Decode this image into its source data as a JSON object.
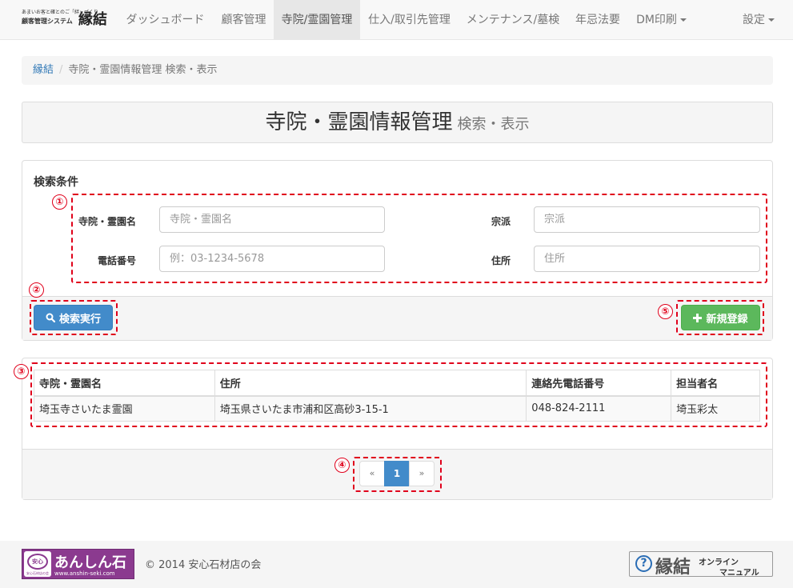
{
  "brand": {
    "tagline": "あまいお客と確とのご「絆」づくり",
    "system": "顧客管理システム",
    "name": "縁結"
  },
  "nav": {
    "items": [
      {
        "label": "ダッシュボード"
      },
      {
        "label": "顧客管理"
      },
      {
        "label": "寺院/霊園管理"
      },
      {
        "label": "仕入/取引先管理"
      },
      {
        "label": "メンテナンス/墓検"
      },
      {
        "label": "年忌法要"
      },
      {
        "label": "DM印刷"
      }
    ],
    "settings": "設定"
  },
  "breadcrumb": {
    "home": "縁結",
    "separator": "/",
    "current": "寺院・霊園情報管理 検索・表示"
  },
  "page_header": {
    "title": "寺院・霊園情報管理",
    "subtitle": "検索・表示"
  },
  "search": {
    "title": "検索条件",
    "fields": {
      "name": {
        "label": "寺院・霊園名",
        "placeholder": "寺院・霊園名",
        "value": ""
      },
      "sect": {
        "label": "宗派",
        "placeholder": "宗派",
        "value": ""
      },
      "phone": {
        "label": "電話番号",
        "placeholder": "例：03-1234-5678",
        "value": ""
      },
      "address": {
        "label": "住所",
        "placeholder": "住所",
        "value": ""
      }
    },
    "search_button": "検索実行",
    "new_button": "新規登録"
  },
  "results": {
    "columns": [
      "寺院・霊園名",
      "住所",
      "連絡先電話番号",
      "担当者名"
    ],
    "rows": [
      [
        "埼玉寺さいたま霊園",
        "埼玉県さいたま市浦和区高砂3-15-1",
        "048-824-2111",
        "埼玉彩太"
      ]
    ]
  },
  "pagination": {
    "prev": "«",
    "current": "1",
    "next": "»"
  },
  "annotations": [
    "①",
    "②",
    "③",
    "④",
    "⑤"
  ],
  "footer": {
    "logo_badge": "安心",
    "logo_badge_sub": "安心石材店の会",
    "logo_text": "あんしん石",
    "logo_url": "www.anshin-seki.com",
    "copyright": "© 2014 安心石材店の会",
    "manual_q": "?",
    "manual_big": "縁結",
    "manual_line1": "オンライン",
    "manual_line2": "マニュアル"
  },
  "colors": {
    "primary": "#428bca",
    "success": "#5cb85c",
    "annotation": "#e0001b",
    "logo_purple": "#8b3a8f"
  }
}
